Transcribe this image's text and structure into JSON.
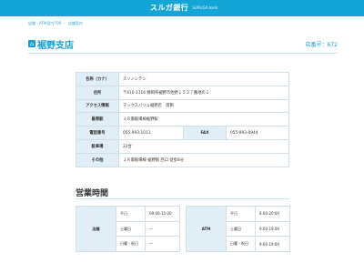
{
  "header": {
    "logo_jp": "スルガ銀行",
    "logo_en": "SURUGA bank"
  },
  "breadcrumb": [
    "店舗・ATM案内TOP",
    "店舗案内"
  ],
  "branch": {
    "icon": "branch-icon",
    "name": "裾野支店",
    "number_label": "店番号：672"
  },
  "info": {
    "name_kana": {
      "label": "名称（カナ）",
      "value": "スソノシテン"
    },
    "address": {
      "label": "住所",
      "value": "〒410-1116 静岡県裾野市佐野１５２７番地の１"
    },
    "access": {
      "label": "アクセス情報",
      "value": "マックスバリュ裾野店　南側"
    },
    "station": {
      "label": "最寄駅",
      "value": "ＪＲ御殿場線裾野駅"
    },
    "phone": {
      "label": "電話番号",
      "value": "055-993-1011"
    },
    "fax": {
      "label": "FAX",
      "value": "055-993-0944"
    },
    "parking": {
      "label": "駐車場",
      "value": "22台"
    },
    "other": {
      "label": "その他",
      "value": "ＪＲ御殿場線 裾野駅 西口 徒歩8分"
    }
  },
  "hours": {
    "title": "営業時間",
    "branch": {
      "label": "店舗",
      "rows": [
        {
          "day": "平日",
          "time": "09:00-15:00"
        },
        {
          "day": "土曜日",
          "time": "ー"
        },
        {
          "day": "日曜・祝日",
          "time": "ー"
        }
      ]
    },
    "atm": {
      "label": "ATM",
      "rows": [
        {
          "day": "平日",
          "time": "8:00-20:00"
        },
        {
          "day": "土曜日",
          "time": "9:00-19:00"
        },
        {
          "day": "日曜・祝日",
          "time": "9:00-19:00"
        }
      ]
    }
  }
}
